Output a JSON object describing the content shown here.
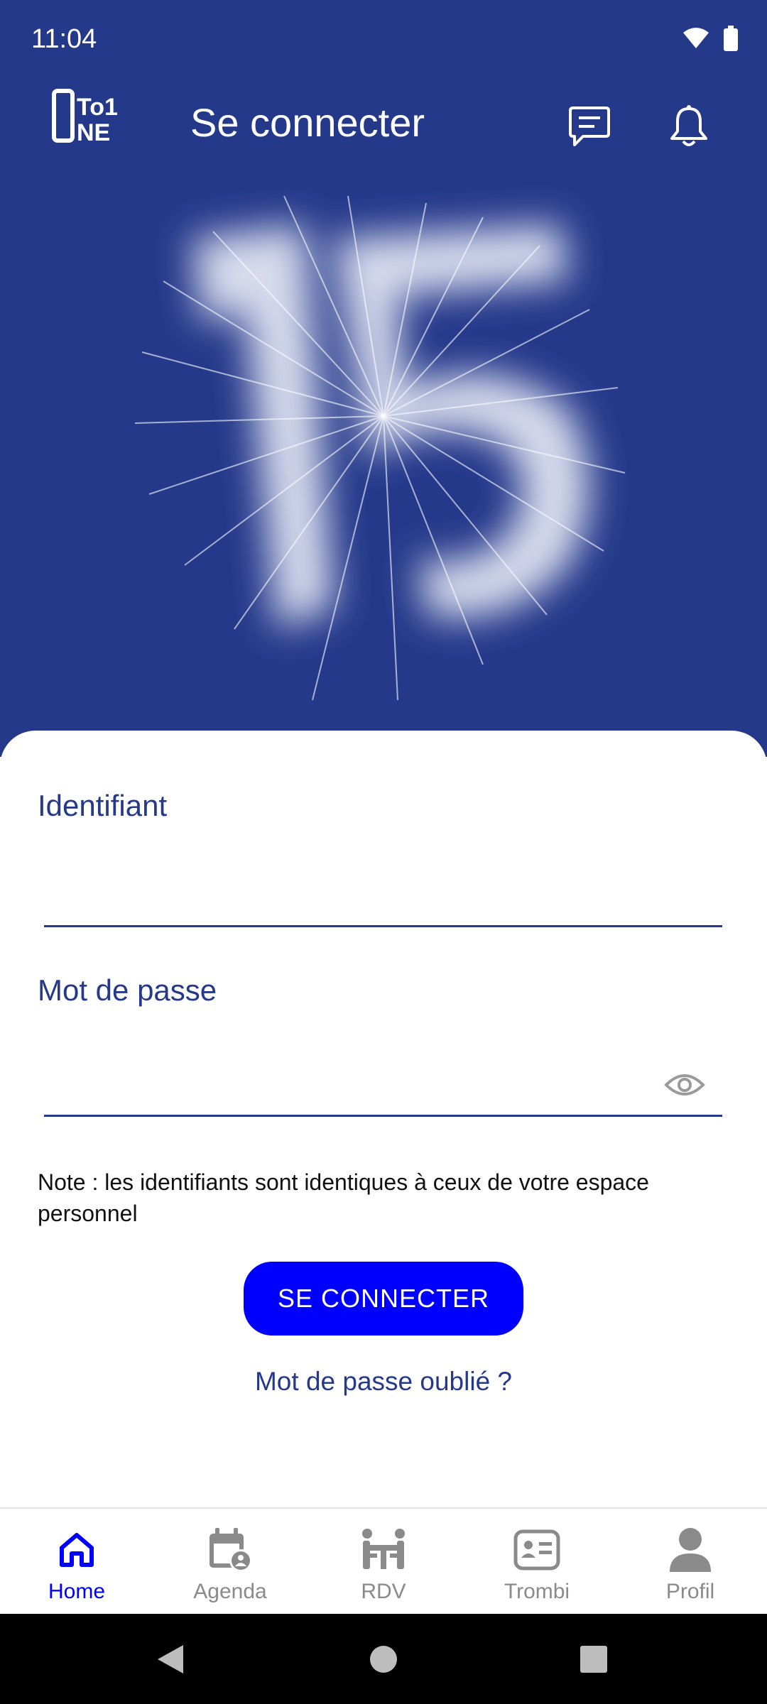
{
  "status": {
    "time": "11:04"
  },
  "appbar": {
    "title": "Se connecter",
    "logo_text": "TO1NE",
    "messages_icon": "chat-icon",
    "notifications_icon": "bell-icon"
  },
  "hero": {
    "graphic": "number 15 glowing with light rays"
  },
  "form": {
    "identifiant_label": "Identifiant",
    "identifiant_value": "",
    "password_label": "Mot de passe",
    "password_value": "",
    "note": "Note : les identifiants sont identiques à ceux de votre espace personnel",
    "submit_label": "SE CONNECTER",
    "forgot_label": "Mot de passe oublié ?"
  },
  "bottom_nav": [
    {
      "label": "Home",
      "icon": "home-icon",
      "active": true
    },
    {
      "label": "Agenda",
      "icon": "calendar-user-icon",
      "active": false
    },
    {
      "label": "RDV",
      "icon": "meeting-icon",
      "active": false
    },
    {
      "label": "Trombi",
      "icon": "id-card-icon",
      "active": false
    },
    {
      "label": "Profil",
      "icon": "person-icon",
      "active": false
    }
  ],
  "colors": {
    "brand": "#25398B",
    "accent": "#0000FF",
    "inactive": "#8a8a8a"
  }
}
